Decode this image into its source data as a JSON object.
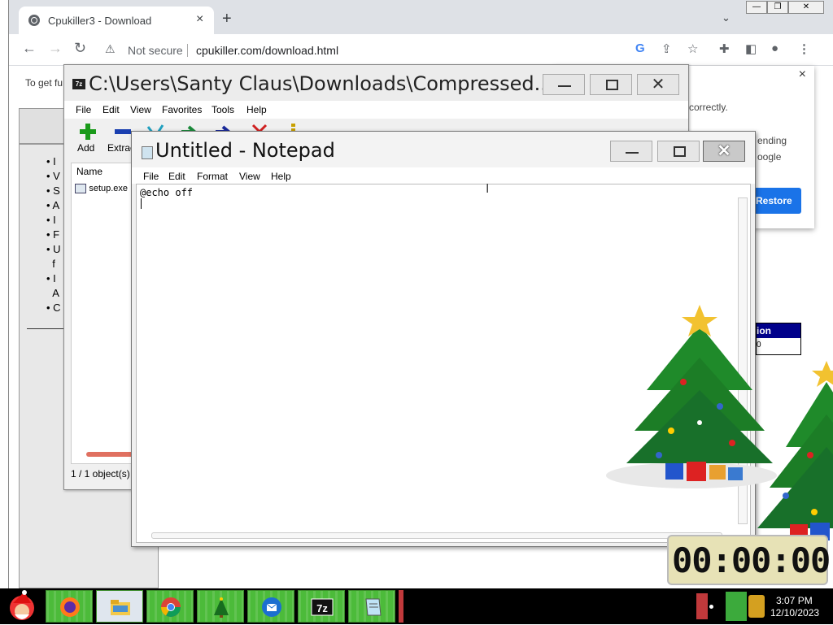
{
  "browser": {
    "tab_title": "Cpukiller3 - Download",
    "close_glyph": "×",
    "new_tab_glyph": "+",
    "tab_dropdown_glyph": "⌄",
    "security_text": "Not secure",
    "url": "cpukiller.com/download.html",
    "info_text": "To get fu",
    "bullet_letters": [
      "I",
      "V",
      "S",
      "A",
      "I",
      "F",
      "U",
      "f",
      "I",
      "A",
      "C"
    ],
    "popup_lines": [
      "correctly.",
      "ending",
      "oogle"
    ],
    "restore_label": "Restore",
    "popup_close": "×",
    "table_header": "ion",
    "table_cell": "0"
  },
  "sevenzip": {
    "title": "C:\\Users\\Santy Claus\\Downloads\\Compressed...",
    "menu": [
      "File",
      "Edit",
      "View",
      "Favorites",
      "Tools",
      "Help"
    ],
    "toolbar": [
      "Add",
      "Extrac"
    ],
    "column_header": "Name",
    "file_name": "setup.exe",
    "status": "1 / 1 object(s)",
    "close_glyph": "✕"
  },
  "notepad": {
    "title": "Untitled - Notepad",
    "menu": [
      "File",
      "Edit",
      "Format",
      "View",
      "Help"
    ],
    "content": "@echo off",
    "close_glyph": "✕"
  },
  "clock": {
    "display": "00:00:00"
  },
  "taskbar": {
    "time": "3:07 PM",
    "date": "12/10/2023",
    "apps": [
      "santa-icon",
      "firefox-icon",
      "file-explorer-icon",
      "chrome-icon",
      "christmas-tree-icon",
      "thunderbird-icon",
      "7zip-icon",
      "notepad-icon"
    ]
  },
  "colors": {
    "taskbar_green": "#4cbb3a",
    "restore_button": "#1a73e8",
    "table_header": "#00008b",
    "clock_face": "#e7e2b6"
  }
}
